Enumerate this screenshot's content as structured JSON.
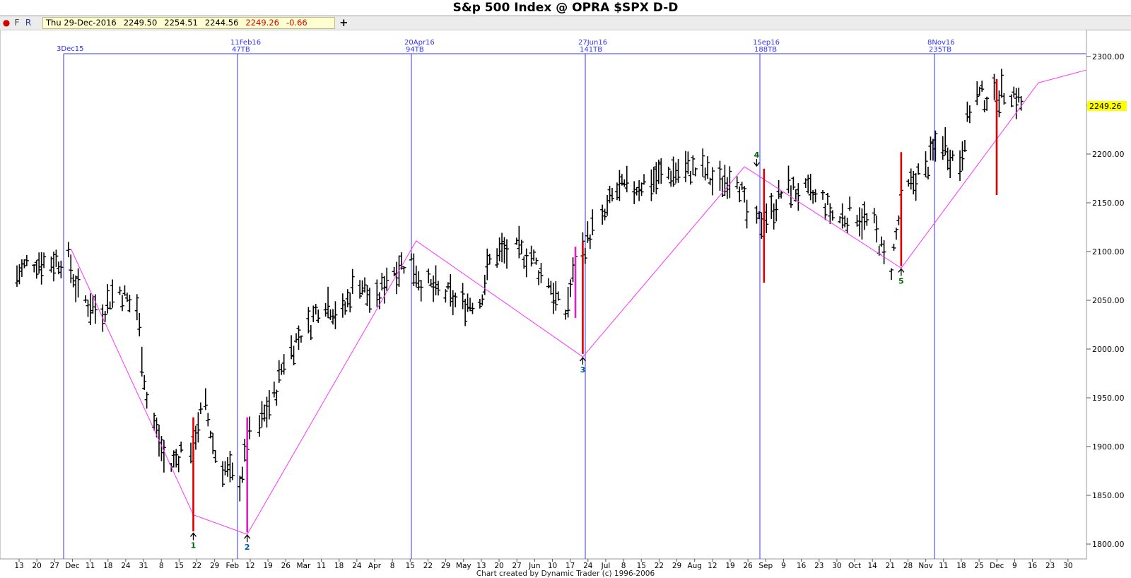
{
  "window": {
    "title": "S&p 500 Index @ OPRA $SPX   D-D"
  },
  "toolbar": {
    "buttons": [
      {
        "label": "●",
        "color": "#d40000"
      },
      {
        "label": "F",
        "color": "#444444"
      },
      {
        "label": "R",
        "color": "#2a3a8a"
      }
    ],
    "quote": {
      "date": "Thu 29-Dec-2016",
      "open": "2249.50",
      "high": "2254.51",
      "low": "2244.56",
      "close": "2249.26",
      "change": "-0.66"
    },
    "add_label": "+"
  },
  "footer": {
    "text": "Chart created by Dynamic Trader  (c) 1996-2006"
  },
  "colors": {
    "bars": "#000000",
    "cycle_lines": "#3333ff",
    "zigzag": "#ff33ff",
    "spikes_red": "#e00000",
    "spikes_magenta": "#e020c0",
    "last_price_bg": "#ffff00",
    "pivot_labels_green": "#006400",
    "pivot_labels_blue": "#005a9c"
  },
  "chart_data": {
    "type": "ohlc-bar",
    "instrument": "S&p 500 Index @ OPRA $SPX",
    "timeframe": "D-D",
    "ylim": [
      1790,
      2320
    ],
    "yticks": [
      "1800.00",
      "1850.00",
      "1900.00",
      "1950.00",
      "2000.00",
      "2050.00",
      "2100.00",
      "2150.00",
      "2200.00",
      "2250.00",
      "2300.00"
    ],
    "last_price": "2249.26",
    "x_tick_labels": [
      "13",
      "20",
      "27",
      "Dec",
      "11",
      "18",
      "24",
      "31",
      "8",
      "15",
      "22",
      "29",
      "Feb",
      "12",
      "19",
      "26",
      "Mar",
      "11",
      "18",
      "24",
      "Apr",
      "8",
      "15",
      "22",
      "29",
      "May",
      "13",
      "20",
      "27",
      "Jun",
      "10",
      "17",
      "24",
      "Jul",
      "8",
      "15",
      "22",
      "29",
      "Aug",
      "12",
      "19",
      "26",
      "Sep",
      "9",
      "16",
      "23",
      "30",
      "Oct",
      "14",
      "21",
      "28",
      "Nov",
      "11",
      "18",
      "25",
      "Dec",
      "9",
      "16",
      "23",
      "30"
    ],
    "cycle_markers": [
      {
        "top": "3Dec15",
        "bottom": ""
      },
      {
        "top": "11Feb16",
        "bottom": "47TB"
      },
      {
        "top": "20Apr16",
        "bottom": "94TB"
      },
      {
        "top": "27Jun16",
        "bottom": "141TB"
      },
      {
        "top": "1Sep16",
        "bottom": "188TB"
      },
      {
        "top": "8Nov16",
        "bottom": "235TB"
      }
    ],
    "zigzag": [
      {
        "date": "2015-12-01",
        "price": 2103
      },
      {
        "date": "2016-01-20",
        "price": 1830
      },
      {
        "date": "2016-02-11",
        "price": 1810
      },
      {
        "date": "2016-04-20",
        "price": 2111
      },
      {
        "date": "2016-06-27",
        "price": 1992
      },
      {
        "date": "2016-09-01",
        "price": 2187
      },
      {
        "date": "2016-11-04",
        "price": 2083
      },
      {
        "date": "2016-12-30",
        "price": 2273
      }
    ],
    "pivots": [
      {
        "label": "1",
        "date": "2016-01-20",
        "price": 1812,
        "dir": "low"
      },
      {
        "label": "2",
        "date": "2016-02-11",
        "price": 1810,
        "dir": "low"
      },
      {
        "label": "3",
        "date": "2016-06-27",
        "price": 1992,
        "dir": "low"
      },
      {
        "label": "4",
        "date": "2016-09-06",
        "price": 2187,
        "dir": "high"
      },
      {
        "label": "5",
        "date": "2016-11-04",
        "price": 2083,
        "dir": "low"
      }
    ],
    "vertical_spikes": [
      {
        "date": "2016-01-20",
        "from": 1813,
        "to": 1930,
        "color": "red"
      },
      {
        "date": "2016-02-11",
        "from": 1812,
        "to": 1930,
        "color": "magenta"
      },
      {
        "date": "2016-06-24",
        "from": 2032,
        "to": 2105,
        "color": "magenta"
      },
      {
        "date": "2016-06-27",
        "from": 1995,
        "to": 2110,
        "color": "red"
      },
      {
        "date": "2016-09-09",
        "from": 2068,
        "to": 2185,
        "color": "red"
      },
      {
        "date": "2016-11-04",
        "from": 2085,
        "to": 2202,
        "color": "red"
      },
      {
        "date": "2016-12-13",
        "from": 2158,
        "to": 2277,
        "color": "red"
      }
    ],
    "series": [
      {
        "dates": [
          "2015-11-09",
          "2015-11-16",
          "2015-11-23",
          "2015-11-30",
          "2015-12-07",
          "2015-12-14",
          "2015-12-21",
          "2015-12-28",
          "2016-01-04",
          "2016-01-11",
          "2016-01-19",
          "2016-01-25",
          "2016-02-01",
          "2016-02-08",
          "2016-02-16",
          "2016-02-22",
          "2016-02-29",
          "2016-03-07",
          "2016-03-14",
          "2016-03-21",
          "2016-03-28",
          "2016-04-04",
          "2016-04-11",
          "2016-04-18",
          "2016-04-25",
          "2016-05-02",
          "2016-05-09",
          "2016-05-16",
          "2016-05-23",
          "2016-05-31",
          "2016-06-06",
          "2016-06-13",
          "2016-06-20",
          "2016-06-27",
          "2016-07-05",
          "2016-07-11",
          "2016-07-18",
          "2016-07-25",
          "2016-08-01",
          "2016-08-08",
          "2016-08-15",
          "2016-08-22",
          "2016-08-29",
          "2016-09-06",
          "2016-09-12",
          "2016-09-19",
          "2016-09-26",
          "2016-10-03",
          "2016-10-10",
          "2016-10-17",
          "2016-10-24",
          "2016-10-31",
          "2016-11-07",
          "2016-11-14",
          "2016-11-21",
          "2016-11-28",
          "2016-12-05",
          "2016-12-12",
          "2016-12-19",
          "2016-12-27"
        ],
        "closes": [
          2075,
          2090,
          2090,
          2092,
          2050,
          2040,
          2060,
          2044,
          1925,
          1880,
          1900,
          1940,
          1880,
          1865,
          1920,
          1950,
          2000,
          2022,
          2050,
          2036,
          2070,
          2047,
          2082,
          2091,
          2065,
          2057,
          2047,
          2050,
          2099,
          2100,
          2096,
          2072,
          2037,
          2100,
          2130,
          2162,
          2165,
          2173,
          2180,
          2184,
          2183,
          2170,
          2180,
          2127,
          2140,
          2165,
          2160,
          2153,
          2133,
          2140,
          2127,
          2085,
          2164,
          2183,
          2213,
          2192,
          2260,
          2258,
          2265,
          2249
        ]
      }
    ]
  }
}
